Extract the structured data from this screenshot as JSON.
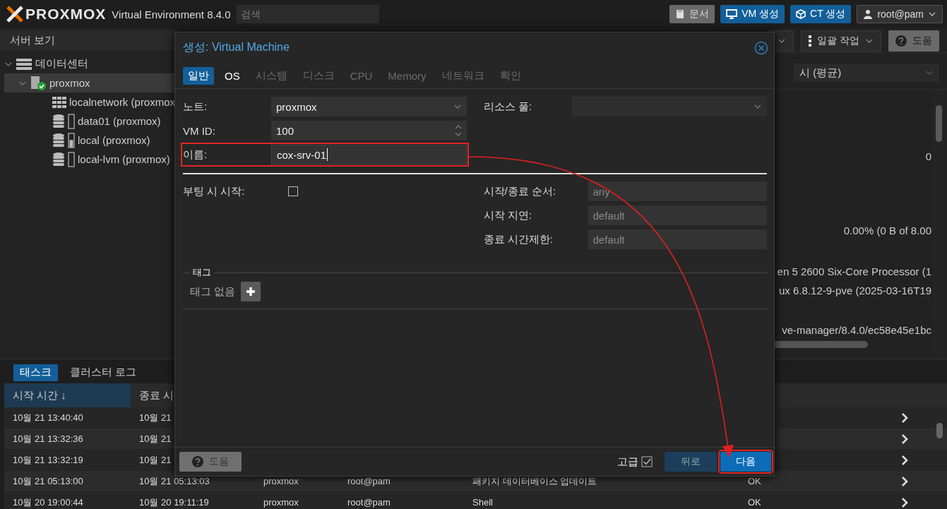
{
  "header": {
    "logo": "PROXMOX",
    "version": "Virtual Environment 8.4.0",
    "search": {
      "placeholder": "검색"
    },
    "buttons": [
      {
        "label": "문서",
        "kind": "docs"
      },
      {
        "label": "VM 생성",
        "kind": "vm"
      },
      {
        "label": "CT 생성",
        "kind": "ct"
      },
      {
        "label": "root@pam",
        "kind": "user"
      }
    ]
  },
  "view_selector": "서버 보기",
  "tree": [
    {
      "label": "데이터센터",
      "kind": "datacenter",
      "expanded": true,
      "selected": false,
      "children": [
        {
          "label": "proxmox",
          "kind": "node",
          "expanded": true,
          "selected": true,
          "children": [
            {
              "label": "localnetwork (proxmox",
              "kind": "network",
              "selected": false
            },
            {
              "label": "data01 (proxmox)",
              "kind": "storage",
              "selected": false
            },
            {
              "label": "local (proxmox)",
              "kind": "storage",
              "level": 0.6,
              "selected": false
            },
            {
              "label": "local-lvm (proxmox)",
              "kind": "storage",
              "selected": false
            }
          ]
        }
      ]
    }
  ],
  "toolbar": {
    "buttons": [
      {
        "kind": "dropdown"
      },
      {
        "label": "일괄 작업",
        "kind": "menu"
      },
      {
        "label": "도움",
        "kind": "help"
      }
    ]
  },
  "summary": {
    "timeframe": "시 (평균)",
    "lines": [
      "0",
      "0.00% (0 B of 8.00",
      "en 5 2600 Six-Core Processor (1",
      "ux 6.8.12-9-pve (2025-03-16T19",
      "ve-manager/8.4.0/ec58e45e1bc"
    ]
  },
  "tasks": {
    "tabs": [
      {
        "label": "태스크",
        "selected": true
      },
      {
        "label": "클러스터 로그",
        "selected": false
      }
    ],
    "columns": [
      {
        "label": "시작 시간 ↓",
        "sorted": true
      },
      {
        "label": "종료 시",
        "sorted": false
      }
    ],
    "rows": [
      {
        "cells": [
          "10월 21 13:40:40",
          "10월 21"
        ]
      },
      {
        "cells": [
          "10월 21 13:32:36",
          "10월 21"
        ]
      },
      {
        "cells": [
          "10월 21 13:32:19",
          "10월 21"
        ]
      },
      {
        "cells": [
          "10월 21 05:13:00",
          "10월 21 05:13:03",
          "proxmox",
          "root@pam",
          "패키지 데이터베이스 업데이트",
          "OK"
        ]
      },
      {
        "cells": [
          "10월 20 19:00:44",
          "10월 20 19:11:19",
          "proxmox",
          "root@pam",
          "Shell",
          "OK"
        ]
      }
    ]
  },
  "dialog": {
    "title": "생성: Virtual Machine",
    "tabs": [
      {
        "label": "일반",
        "selected": true,
        "disabled": false
      },
      {
        "label": "OS",
        "selected": false,
        "disabled": false
      },
      {
        "label": "시스템",
        "selected": false,
        "disabled": true
      },
      {
        "label": "디스크",
        "selected": false,
        "disabled": true
      },
      {
        "label": "CPU",
        "selected": false,
        "disabled": true
      },
      {
        "label": "Memory",
        "selected": false,
        "disabled": true
      },
      {
        "label": "네트워크",
        "selected": false,
        "disabled": true
      },
      {
        "label": "확인",
        "selected": false,
        "disabled": true
      }
    ],
    "left_fields": [
      {
        "label": "노트:",
        "value": "proxmox",
        "kind": "combo"
      },
      {
        "label": "VM ID:",
        "value": "100",
        "kind": "spinner"
      },
      {
        "label": "이름:",
        "value": "cox-srv-01",
        "kind": "text",
        "highlighted": true
      }
    ],
    "right_fields": [
      {
        "label": "리소스 풀:",
        "kind": "combo"
      }
    ],
    "advanced_left": [
      {
        "label": "부팅 시 시작:",
        "kind": "checkbox",
        "checked": false
      }
    ],
    "advanced_right": [
      {
        "label": "시작/종료 순서:",
        "placeholder": "any"
      },
      {
        "label": "시작 지연:",
        "placeholder": "default"
      },
      {
        "label": "종료 시간제한:",
        "placeholder": "default"
      }
    ],
    "tags": {
      "legend": "태그",
      "empty_text": "태그 없음"
    },
    "footer": {
      "help": "도움",
      "advanced": {
        "label": "고급",
        "checked": true
      },
      "back": {
        "label": "뒤로",
        "disabled": true
      },
      "next": {
        "label": "다음",
        "highlighted": true
      }
    }
  },
  "annotation_arrow": true
}
